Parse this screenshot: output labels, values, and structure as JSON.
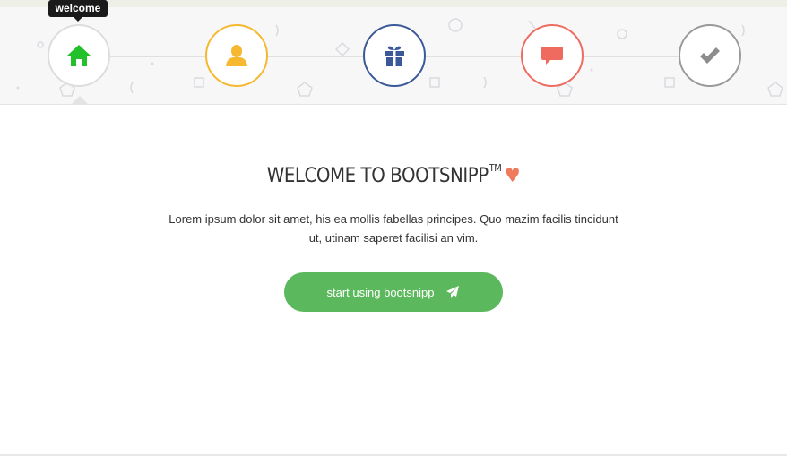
{
  "wizard": {
    "steps": [
      {
        "id": "home",
        "icon": "home-icon",
        "color": "#22c02a",
        "active": true
      },
      {
        "id": "profile",
        "icon": "user-icon",
        "color": "#f5b82e"
      },
      {
        "id": "gift",
        "icon": "gift-icon",
        "color": "#3b5998"
      },
      {
        "id": "comments",
        "icon": "comment-icon",
        "color": "#ef6a5f"
      },
      {
        "id": "done",
        "icon": "check-icon",
        "color": "#9a9a9a"
      }
    ],
    "tooltip": "welcome"
  },
  "content": {
    "title": "WELCOME TO BOOTSNIPP",
    "trademark": "TM",
    "heart": "♥",
    "lead": "Lorem ipsum dolor sit amet, his ea mollis fabellas principes. Quo mazim facilis tincidunt ut, utinam saperet facilisi an vim.",
    "cta_label": "start using bootsnipp",
    "cta_icon": "paper-plane-icon"
  },
  "colors": {
    "accent_green": "#5cb85c",
    "heart": "#f07a5c"
  }
}
